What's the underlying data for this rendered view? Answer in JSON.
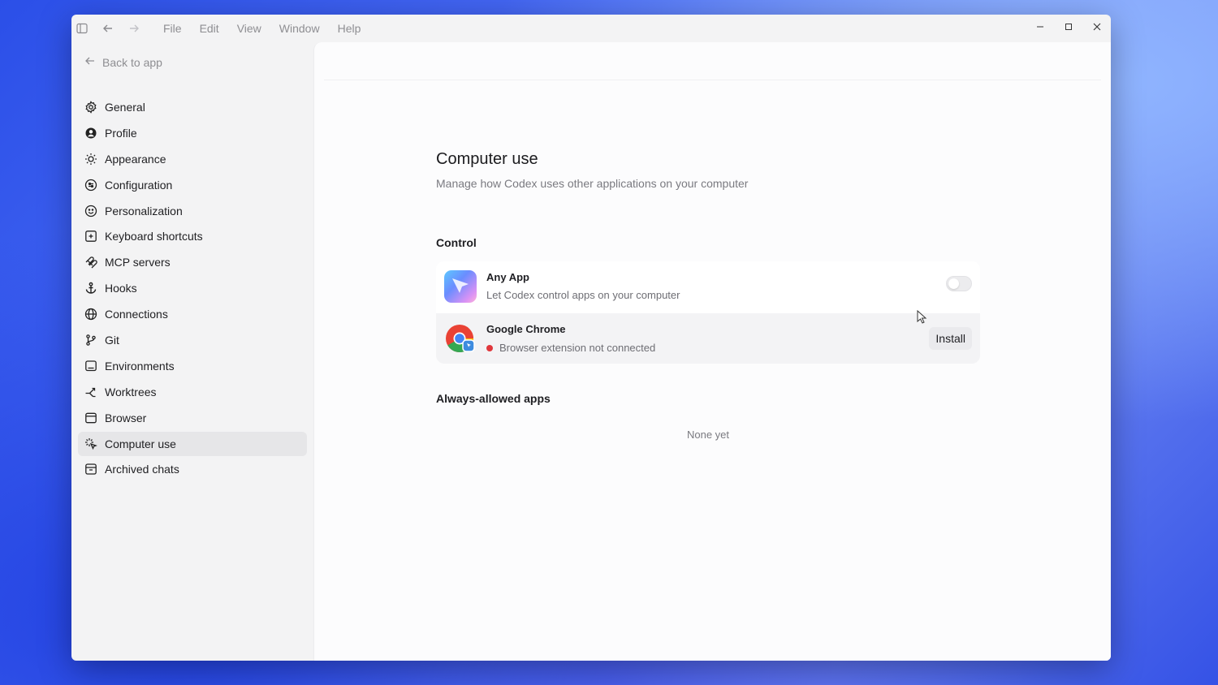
{
  "menu": [
    "File",
    "Edit",
    "View",
    "Window",
    "Help"
  ],
  "sidebar": {
    "back_label": "Back to app",
    "items": [
      {
        "label": "General",
        "icon": "gear-icon"
      },
      {
        "label": "Profile",
        "icon": "user-icon"
      },
      {
        "label": "Appearance",
        "icon": "sun-icon"
      },
      {
        "label": "Configuration",
        "icon": "config-icon"
      },
      {
        "label": "Personalization",
        "icon": "smile-icon"
      },
      {
        "label": "Keyboard shortcuts",
        "icon": "keyboard-icon"
      },
      {
        "label": "MCP servers",
        "icon": "mcp-icon"
      },
      {
        "label": "Hooks",
        "icon": "anchor-icon"
      },
      {
        "label": "Connections",
        "icon": "globe-icon"
      },
      {
        "label": "Git",
        "icon": "branch-icon"
      },
      {
        "label": "Environments",
        "icon": "monitor-icon"
      },
      {
        "label": "Worktrees",
        "icon": "worktree-icon"
      },
      {
        "label": "Browser",
        "icon": "browser-icon"
      },
      {
        "label": "Computer use",
        "icon": "sparkle-cursor-icon",
        "active": true
      },
      {
        "label": "Archived chats",
        "icon": "archive-icon"
      }
    ]
  },
  "main": {
    "title": "Computer use",
    "subtitle": "Manage how Codex uses other applications on your computer",
    "control_label": "Control",
    "any_app": {
      "title": "Any App",
      "desc": "Let Codex control apps on your computer",
      "toggle_on": false
    },
    "chrome": {
      "title": "Google Chrome",
      "status": "Browser extension not connected",
      "status_color": "#e0373c",
      "button": "Install"
    },
    "allowed_label": "Always-allowed apps",
    "allowed_empty": "None yet"
  }
}
